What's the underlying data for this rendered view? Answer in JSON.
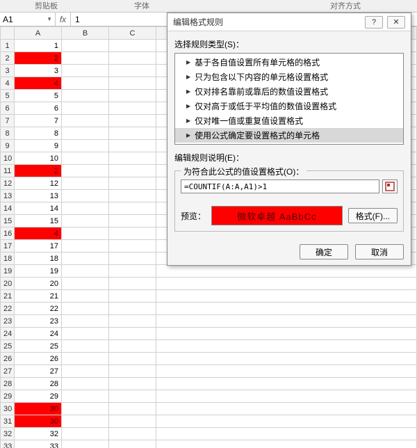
{
  "ribbon": {
    "group1": "剪贴板",
    "group2": "字体",
    "group3": "对齐方式"
  },
  "namebox": {
    "value": "A1"
  },
  "formula_bar": {
    "fx": "fx",
    "value": "1"
  },
  "columns": [
    "A",
    "B",
    "C"
  ],
  "rows": [
    {
      "n": 1,
      "a": "1",
      "hl": false
    },
    {
      "n": 2,
      "a": "2",
      "hl": true
    },
    {
      "n": 3,
      "a": "3",
      "hl": false
    },
    {
      "n": 4,
      "a": "4",
      "hl": true
    },
    {
      "n": 5,
      "a": "5",
      "hl": false
    },
    {
      "n": 6,
      "a": "6",
      "hl": false
    },
    {
      "n": 7,
      "a": "7",
      "hl": false
    },
    {
      "n": 8,
      "a": "8",
      "hl": false
    },
    {
      "n": 9,
      "a": "9",
      "hl": false
    },
    {
      "n": 10,
      "a": "10",
      "hl": false
    },
    {
      "n": 11,
      "a": "2",
      "hl": true
    },
    {
      "n": 12,
      "a": "12",
      "hl": false
    },
    {
      "n": 13,
      "a": "13",
      "hl": false
    },
    {
      "n": 14,
      "a": "14",
      "hl": false
    },
    {
      "n": 15,
      "a": "15",
      "hl": false
    },
    {
      "n": 16,
      "a": "4",
      "hl": true
    },
    {
      "n": 17,
      "a": "17",
      "hl": false
    },
    {
      "n": 18,
      "a": "18",
      "hl": false
    },
    {
      "n": 19,
      "a": "19",
      "hl": false
    },
    {
      "n": 20,
      "a": "20",
      "hl": false
    },
    {
      "n": 21,
      "a": "21",
      "hl": false
    },
    {
      "n": 22,
      "a": "22",
      "hl": false
    },
    {
      "n": 23,
      "a": "23",
      "hl": false
    },
    {
      "n": 24,
      "a": "24",
      "hl": false
    },
    {
      "n": 25,
      "a": "25",
      "hl": false
    },
    {
      "n": 26,
      "a": "26",
      "hl": false
    },
    {
      "n": 27,
      "a": "27",
      "hl": false
    },
    {
      "n": 28,
      "a": "28",
      "hl": false
    },
    {
      "n": 29,
      "a": "29",
      "hl": false
    },
    {
      "n": 30,
      "a": "30",
      "hl": true
    },
    {
      "n": 31,
      "a": "30",
      "hl": true
    },
    {
      "n": 32,
      "a": "32",
      "hl": false
    },
    {
      "n": 33,
      "a": "33",
      "hl": false
    }
  ],
  "dialog": {
    "title": "编辑格式规则",
    "help": "?",
    "close": "✕",
    "select_rule_label": "选择规则类型(S)：",
    "rule_types": [
      "基于各自值设置所有单元格的格式",
      "只为包含以下内容的单元格设置格式",
      "仅对排名靠前或靠后的数值设置格式",
      "仅对高于或低于平均值的数值设置格式",
      "仅对唯一值或重复值设置格式",
      "使用公式确定要设置格式的单元格"
    ],
    "rule_selected_index": 5,
    "rule_desc_label": "编辑规则说明(E)：",
    "formula_label": "为符合此公式的值设置格式(O)：",
    "formula_value": "=COUNTIF(A:A,A1)>1",
    "preview_label": "预览：",
    "preview_sample": "微软卓越  AaBbCc",
    "format_btn": "格式(F)...",
    "ok": "确定",
    "cancel": "取消"
  }
}
